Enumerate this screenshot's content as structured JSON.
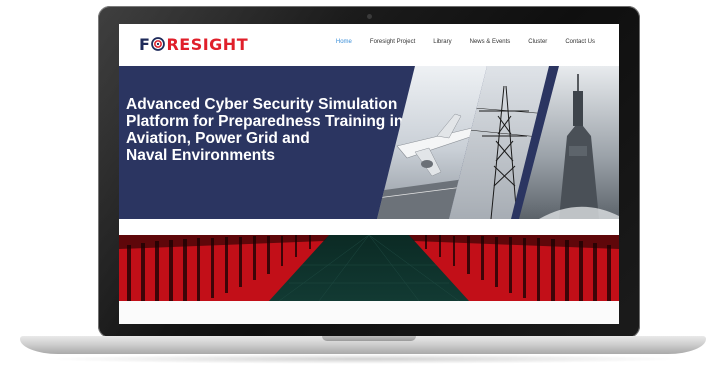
{
  "site": {
    "logo": {
      "prefix": "F",
      "suffix": "RESIGHT"
    },
    "nav": [
      "Home",
      "Foresight Project",
      "Library",
      "News & Events",
      "Cluster",
      "Contact Us"
    ],
    "active_nav": "Home"
  },
  "hero": {
    "title_lines": [
      "Advanced Cyber Security Simulation",
      "Platform for Preparedness Training in",
      "Aviation, Power Grid and",
      "Naval Environments"
    ]
  },
  "colors": {
    "hero_bg": "#2b3561",
    "logo_red": "#e01f2a",
    "logo_navy": "#1e2a5a",
    "nav_active": "#3b8fd9",
    "server_red": "#d0101a"
  }
}
